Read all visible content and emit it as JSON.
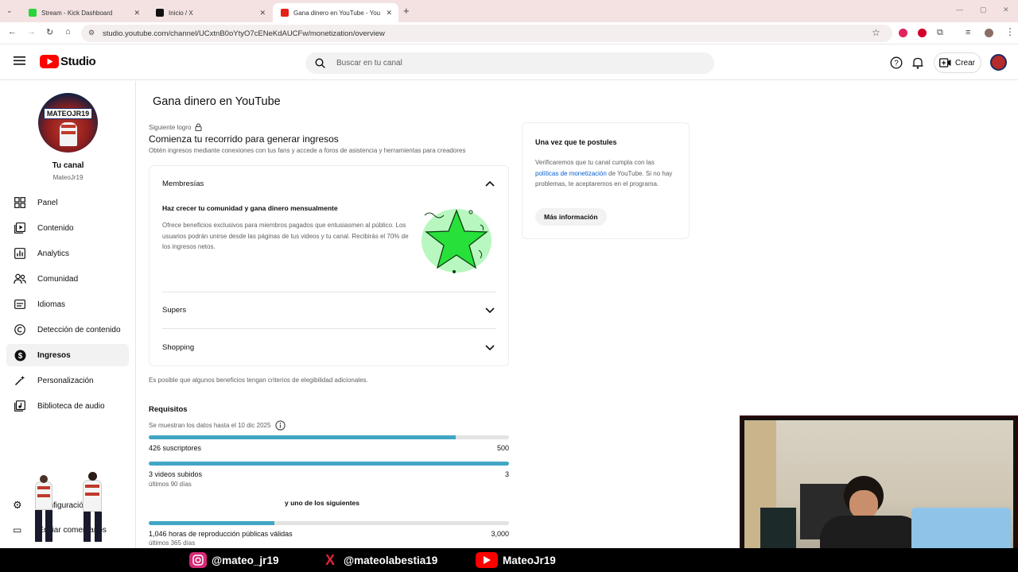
{
  "browser": {
    "tabs": [
      {
        "title": "Stream - Kick Dashboard",
        "favicon_color": "#2bd43a"
      },
      {
        "title": "Inicio / X",
        "favicon_color": "#111111"
      },
      {
        "title": "Gana dinero en YouTube - You",
        "favicon_color": "#e62117"
      }
    ],
    "new_tab": "+",
    "url": "studio.youtube.com/channel/UCxtnB0oYtyO7cENeKdAUCFw/monetization/overview"
  },
  "header": {
    "logo_text": "Studio",
    "search_placeholder": "Buscar en tu canal",
    "create_label": "Crear"
  },
  "sidebar": {
    "avatar_text": "MATEOJR19",
    "channel_label": "Tu canal",
    "channel_name": "MateoJr19",
    "items": [
      {
        "label": "Panel",
        "icon": "dashboard-icon"
      },
      {
        "label": "Contenido",
        "icon": "content-icon"
      },
      {
        "label": "Analytics",
        "icon": "analytics-icon"
      },
      {
        "label": "Comunidad",
        "icon": "community-icon"
      },
      {
        "label": "Idiomas",
        "icon": "subtitles-icon"
      },
      {
        "label": "Detección de contenido",
        "icon": "copyright-icon"
      },
      {
        "label": "Ingresos",
        "icon": "earn-icon"
      },
      {
        "label": "Personalización",
        "icon": "magic-wand-icon"
      },
      {
        "label": "Biblioteca de audio",
        "icon": "audio-library-icon"
      }
    ],
    "settings_label": "Configuración",
    "feedback_label": "Enviar comentarios"
  },
  "main": {
    "page_title": "Gana dinero en YouTube",
    "next_milestone": "Siguiente logro",
    "journey_title": "Comienza tu recorrido para generar ingresos",
    "journey_subtitle": "Obtén ingresos mediante conexiones con tus fans y accede a foros de asistencia y herramientas para creadores",
    "membership": {
      "title": "Membresías",
      "heading": "Haz crecer tu comunidad y gana dinero mensualmente",
      "body": "Ofrece beneficios exclusivos para miembros pagados que entusiasmen al público. Los usuarios podrán unirse desde las páginas de tus videos y tu canal. Recibirás el 70% de los ingresos netos."
    },
    "supers_title": "Supers",
    "shopping_title": "Shopping",
    "eligibility_note": "Es posible que algunos beneficios tengan criterios de elegibilidad adicionales.",
    "requirements": {
      "title": "Requisitos",
      "data_note": "Se muestran los datos hasta el 10 dic 2025",
      "subs": {
        "label": "426 suscriptores",
        "target": "500",
        "progress": 0.852
      },
      "videos": {
        "label": "3 videos subidos",
        "target": "3",
        "sub": "últimos 90 días",
        "progress": 1.0
      },
      "one_of": "y uno de los siguientes",
      "hours": {
        "label": "1,046 horas de reproducción públicas válidas",
        "target": "3,000",
        "sub": "últimos 365 días",
        "progress": 0.349
      }
    },
    "apply_card": {
      "title": "Una vez que te postules",
      "body_before": "Verificaremos que tu canal cumpla con las ",
      "link": "políticas de monetización",
      "body_after": " de YouTube. Si no hay problemas, te aceptaremos en el programa.",
      "button": "Más información"
    }
  },
  "stream_overlay": {
    "instagram": "@mateo_jr19",
    "x": "@mateolabestia19",
    "youtube": "MateoJr19"
  },
  "colors": {
    "accent": "#41a6c4",
    "youtube_red": "#ff0000",
    "link": "#065fd4",
    "membership_star": "#27e13a"
  }
}
